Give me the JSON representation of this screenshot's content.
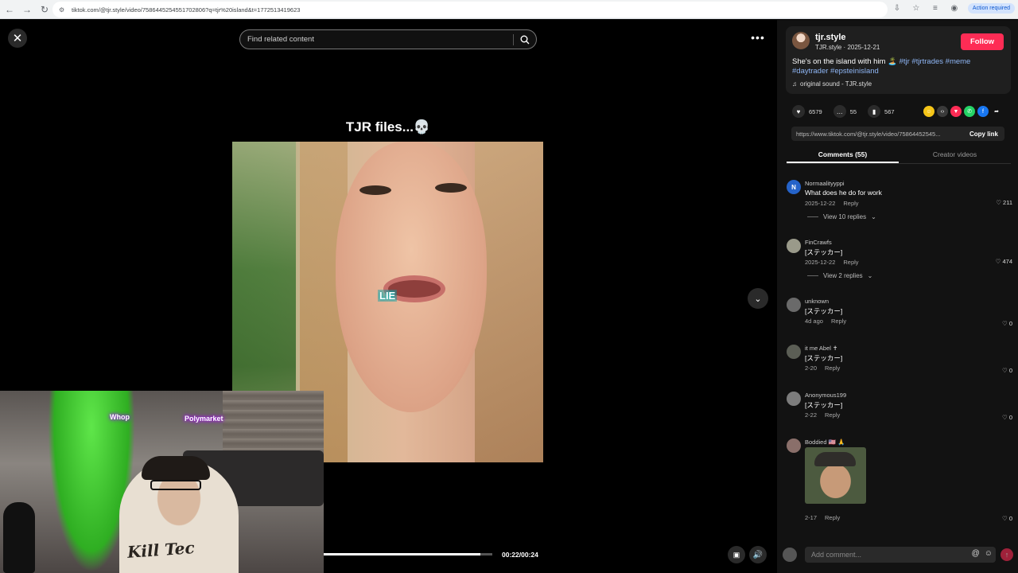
{
  "browser": {
    "url": "tiktok.com/@tjr.style/video/7586445254551702806?q=tjr%20island&t=1772513419623",
    "action_required": "Action required"
  },
  "player": {
    "search_placeholder": "Find related content",
    "video_caption": "TJR files...💀",
    "sticker_text": "LIE",
    "time": "00:22/00:24",
    "progress_fraction": 0.93
  },
  "webcam": {
    "neon_left": "Whop",
    "neon_right": "Polymarket",
    "shirt": "Kill Tec"
  },
  "post": {
    "author": "tjr.style",
    "author_sub": "TJR.style · 2025-12-21",
    "follow_label": "Follow",
    "description": "She's on the island with him 🏝️",
    "hashtags": "#tjr #tjrtrades #meme #daytrader #epsteinisland",
    "sound": "original sound - TJR.style"
  },
  "stats": {
    "likes": "6579",
    "comments": "55",
    "saves": "567"
  },
  "link": {
    "url": "https://www.tiktok.com/@tjr.style/video/75864452545...",
    "copy_label": "Copy link"
  },
  "tabs": {
    "comments": "Comments (55)",
    "creator": "Creator videos"
  },
  "comments": [
    {
      "user": "Normaalityyppi",
      "text": "What does he do for work",
      "date": "2025-12-22",
      "reply": "Reply",
      "likes": "211",
      "replies": "View 10 replies",
      "initial": "N",
      "color": "#2563c9"
    },
    {
      "user": "FinCrawfs",
      "text": "[ステッカー]",
      "date": "2025-12-22",
      "reply": "Reply",
      "likes": "474",
      "replies": "View 2 replies"
    },
    {
      "user": "unknown",
      "text": "[ステッカー]",
      "date": "4d ago",
      "reply": "Reply",
      "likes": "0"
    },
    {
      "user": "it me Abel ✝",
      "text": "[ステッカー]",
      "date": "2-20",
      "reply": "Reply",
      "likes": "0"
    },
    {
      "user": "Anonymous199",
      "text": "[ステッカー]",
      "date": "2-22",
      "reply": "Reply",
      "likes": "0"
    },
    {
      "user": "Boddied 🇺🇸 🙏",
      "text": "",
      "date": "2-17",
      "reply": "Reply",
      "likes": "0"
    }
  ],
  "composer": {
    "placeholder": "Add comment..."
  },
  "colors": {
    "brand": "#fe2c55",
    "hashtag": "#8fb6f5",
    "panel": "#121212"
  }
}
